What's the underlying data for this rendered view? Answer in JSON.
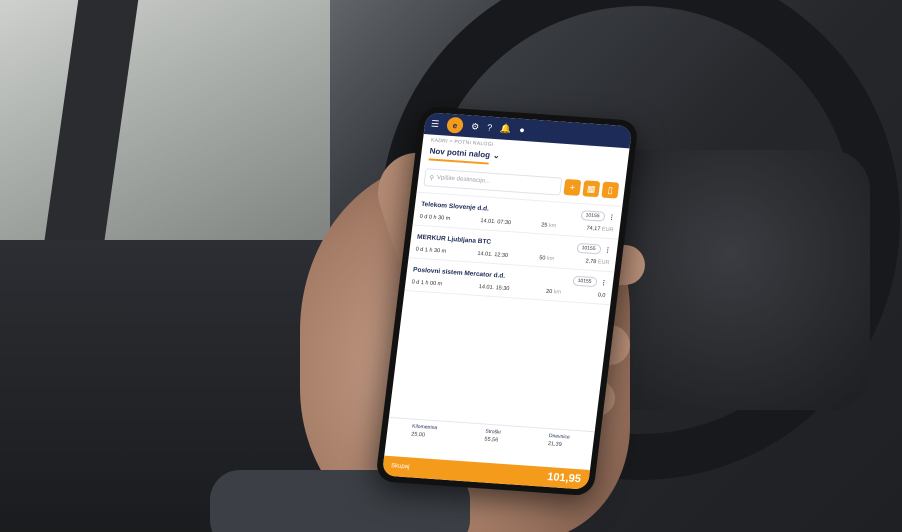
{
  "app": {
    "breadcrumb": "KADRI > POTNI NALOGI",
    "title": "Nov potni nalog",
    "help_icon": "?",
    "search_placeholder": "Vpišite destinacijo...",
    "add_label": "+"
  },
  "trips": [
    {
      "name": "Telekom Slovenje d.d.",
      "tag": "10155",
      "duration": "0 d 0 h 30 m",
      "time": "14.01. 07:30",
      "distance": "25",
      "unit": "km",
      "amount": "74,17",
      "currency": "EUR"
    },
    {
      "name": "MERKUR Ljubljana BTC",
      "tag": "10155",
      "duration": "0 d 1 h 30 m",
      "time": "14.01. 12:30",
      "distance": "50",
      "unit": "km",
      "amount": "2,78",
      "currency": "EUR"
    },
    {
      "name": "Poslovni sistem Mercator d.d.",
      "tag": "10155",
      "duration": "0 d 1 h 00 m",
      "time": "14.01. 15:30",
      "distance": "20",
      "unit": "km",
      "amount": "0,0",
      "currency": ""
    }
  ],
  "totals": [
    {
      "label": "Kilometrina",
      "value": "25,00"
    },
    {
      "label": "Stroški",
      "value": "55,56"
    },
    {
      "label": "Dnevnice",
      "value": "21,39"
    }
  ],
  "footer": {
    "label": "Skupaj",
    "total": "101,95"
  }
}
